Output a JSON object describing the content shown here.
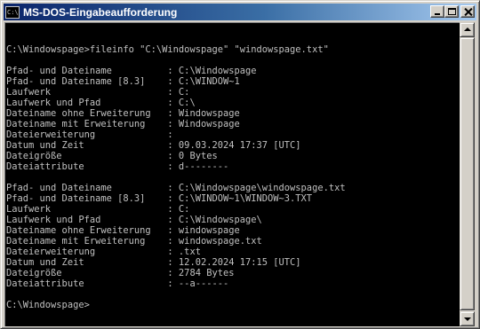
{
  "window": {
    "title": "MS-DOS-Eingabeaufforderung",
    "icon_label": "C:\\",
    "buttons": {
      "minimize": "minimize-icon",
      "maximize": "maximize-icon",
      "close": "close-icon"
    }
  },
  "colors": {
    "titlebar_start": "#0a246a",
    "titlebar_end": "#a6caf0",
    "console_bg": "#000000",
    "console_fg": "#c0c0c0"
  },
  "console": {
    "lines": [
      "",
      "C:\\Windowspage>fileinfo \"C:\\Windowspage\" \"windowspage.txt\"",
      "",
      "Pfad- und Dateiname          : C:\\Windowspage",
      "Pfad- und Dateiname [8.3]    : C:\\WINDOW~1",
      "Laufwerk                     : C:",
      "Laufwerk und Pfad            : C:\\",
      "Dateiname ohne Erweiterung   : Windowspage",
      "Dateiname mit Erweiterung    : Windowspage",
      "Dateierweiterung             :",
      "Datum und Zeit               : 09.03.2024 17:37 [UTC]",
      "Dateigröße                   : 0 Bytes",
      "Dateiattribute               : d--------",
      "",
      "Pfad- und Dateiname          : C:\\Windowspage\\windowspage.txt",
      "Pfad- und Dateiname [8.3]    : C:\\WINDOW~1\\WINDOW~3.TXT",
      "Laufwerk                     : C:",
      "Laufwerk und Pfad            : C:\\Windowspage\\",
      "Dateiname ohne Erweiterung   : windowspage",
      "Dateiname mit Erweiterung    : windowspage.txt",
      "Dateierweiterung             : .txt",
      "Datum und Zeit               : 12.02.2024 17:15 [UTC]",
      "Dateigröße                   : 2784 Bytes",
      "Dateiattribute               : --a------",
      "",
      "C:\\Windowspage>"
    ]
  }
}
